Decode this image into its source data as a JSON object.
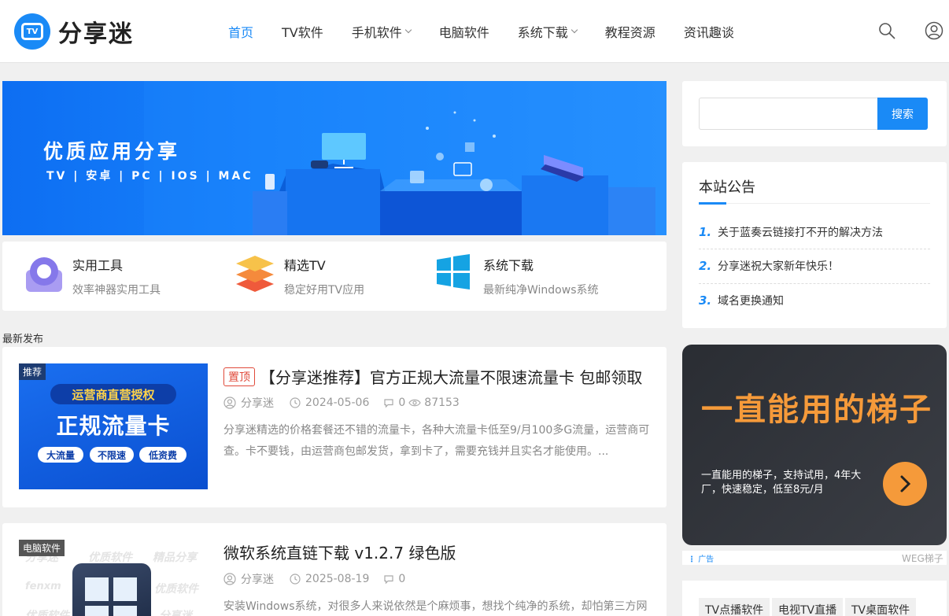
{
  "header": {
    "logo_badge": "TV",
    "logo_text": "分享迷",
    "nav": [
      {
        "label": "首页"
      },
      {
        "label": "TV软件"
      },
      {
        "label": "手机软件"
      },
      {
        "label": "电脑软件"
      },
      {
        "label": "系统下载"
      },
      {
        "label": "教程资源"
      },
      {
        "label": "资讯趣谈"
      }
    ],
    "icons": [
      "search-icon",
      "user-icon"
    ]
  },
  "banner": {
    "title": "优质应用分享",
    "subtitle": "TV | 安卓 | PC | IOS | MAC"
  },
  "categories": [
    {
      "title": "实用工具",
      "desc": "效率神器实用工具"
    },
    {
      "title": "精选TV",
      "desc": "稳定好用TV应用"
    },
    {
      "title": "系统下载",
      "desc": "最新纯净Windows系统"
    }
  ],
  "section_label": "最新发布",
  "posts": [
    {
      "tag": "推荐",
      "sticky": "置顶",
      "title": "【分享迷推荐】官方正规大流量不限速流量卡 包邮领取",
      "author": "分享迷",
      "date": "2024-05-06",
      "comments": "0",
      "views": "87153",
      "excerpt": "分享迷精选的价格套餐还不错的流量卡，各种大流量卡低至9/月100多G流量，运营商可查。卡不要钱，由运营商包邮发货，拿到卡了，需要充钱并且实名才能使用。...",
      "thumb": {
        "top": "运营商直营授权",
        "main": "正规流量卡",
        "chips": [
          "大流量",
          "不限速",
          "低资费"
        ]
      }
    },
    {
      "tag": "电脑软件",
      "title": "微软系统直链下载 v1.2.7 绿色版",
      "author": "分享迷",
      "date": "2025-08-19",
      "comments": "0",
      "excerpt": "安装Windows系统，对很多人来说依然是个麻烦事，想找个纯净的系统，却怕第三方网",
      "thumb": {
        "watermarks": [
          "分享迷",
          "优质软件",
          "精品分享",
          "fenxm",
          "优质软件",
          "优质软件",
          "分享迷"
        ]
      }
    }
  ],
  "sidebar": {
    "search_button": "搜索",
    "search_placeholder": "",
    "notice_title": "本站公告",
    "notices": [
      {
        "num": "1.",
        "text": "关于蓝奏云链接打不开的解决方法"
      },
      {
        "num": "2.",
        "text": "分享迷祝大家新年快乐！"
      },
      {
        "num": "3.",
        "text": "域名更换通知"
      }
    ],
    "ad": {
      "headline": "一直能用的梯子",
      "text": "一直能用的梯子，支持试用，4年大厂，快速稳定，低至8元/月",
      "label": "广告",
      "brand": "WEG梯子"
    },
    "tags": [
      "TV点播软件",
      "电视TV直播",
      "TV桌面软件"
    ]
  },
  "colors": {
    "accent": "#1a8af6",
    "sticky": "#e04a3a",
    "ad_orange": "#f59a3a"
  }
}
